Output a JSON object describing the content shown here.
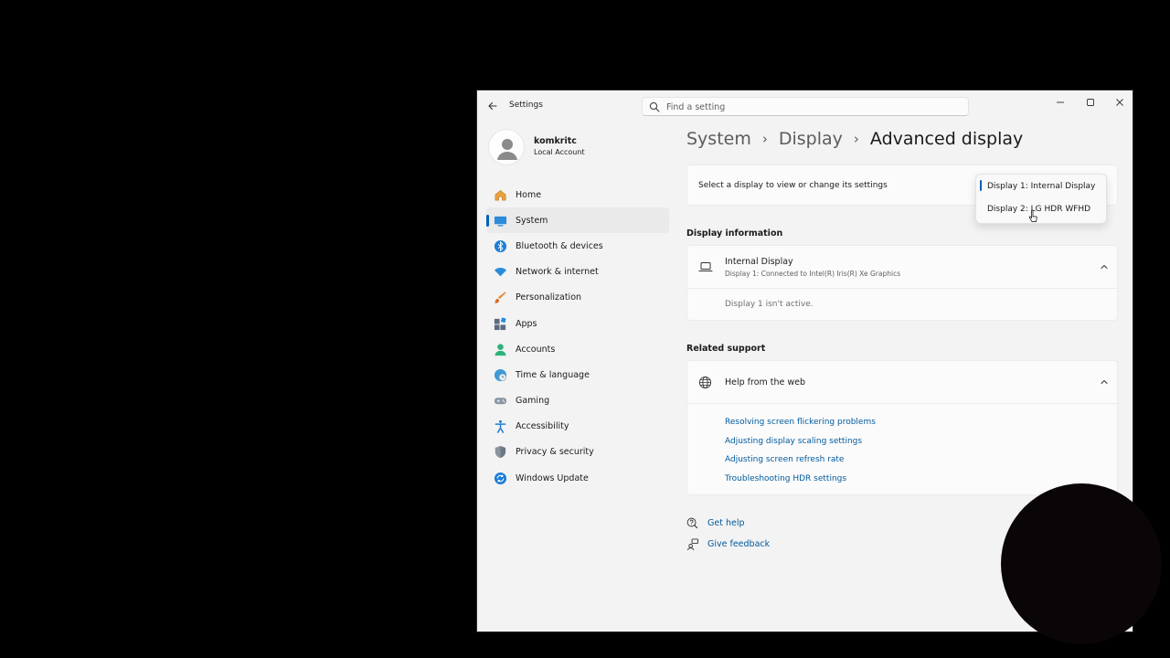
{
  "window": {
    "title": "Settings",
    "search": {
      "placeholder": "Find a setting",
      "value": ""
    }
  },
  "profile": {
    "name": "komkritc",
    "account_type": "Local Account"
  },
  "nav": {
    "items": [
      {
        "label": "Home",
        "icon": "home-icon"
      },
      {
        "label": "System",
        "icon": "system-icon",
        "active": true
      },
      {
        "label": "Bluetooth & devices",
        "icon": "bluetooth-icon"
      },
      {
        "label": "Network & internet",
        "icon": "wifi-icon"
      },
      {
        "label": "Personalization",
        "icon": "brush-icon"
      },
      {
        "label": "Apps",
        "icon": "apps-icon"
      },
      {
        "label": "Accounts",
        "icon": "accounts-icon"
      },
      {
        "label": "Time & language",
        "icon": "globe-clock-icon"
      },
      {
        "label": "Gaming",
        "icon": "gamepad-icon"
      },
      {
        "label": "Accessibility",
        "icon": "accessibility-icon"
      },
      {
        "label": "Privacy & security",
        "icon": "shield-icon"
      },
      {
        "label": "Windows Update",
        "icon": "update-icon"
      }
    ]
  },
  "breadcrumb": {
    "items": [
      "System",
      "Display",
      "Advanced display"
    ],
    "separator": "›"
  },
  "display_select": {
    "label": "Select a display to view or change its settings",
    "options": [
      "Display 1: Internal Display",
      "Display 2: LG HDR WFHD"
    ],
    "selected": "Display 1: Internal Display"
  },
  "display_info": {
    "section_title": "Display information",
    "title": "Internal Display",
    "subtitle": "Display 1: Connected to Intel(R) Iris(R) Xe Graphics",
    "body": "Display 1 isn't active."
  },
  "related_support": {
    "section_title": "Related support",
    "help_title": "Help from the web",
    "links": [
      "Resolving screen flickering problems",
      "Adjusting display scaling settings",
      "Adjusting screen refresh rate",
      "Troubleshooting HDR settings"
    ]
  },
  "footer": {
    "get_help": "Get help",
    "give_feedback": "Give feedback"
  },
  "colors": {
    "accent": "#005fb8",
    "link": "#005a9e",
    "background": "#f3f3f3",
    "card": "#fbfbfb"
  }
}
